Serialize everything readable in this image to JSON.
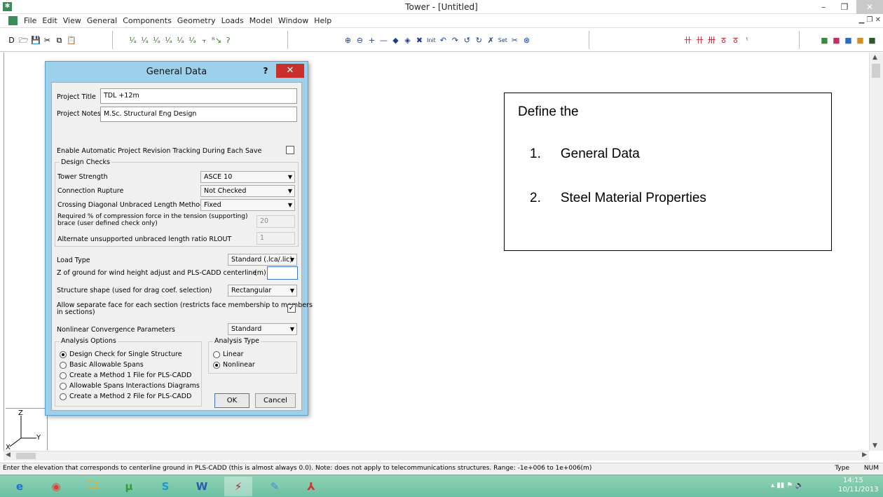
{
  "window": {
    "title": "Tower - [Untitled]",
    "min": "–",
    "max": "❐",
    "close": "✕"
  },
  "menu": [
    "File",
    "Edit",
    "View",
    "General",
    "Components",
    "Geometry",
    "Loads",
    "Model",
    "Window",
    "Help"
  ],
  "toolbar": {
    "file_icons": [
      "D",
      "🗁",
      "💾",
      "✂",
      "⧉",
      "📋"
    ],
    "geom_icons": [
      "⅟ₐ",
      "⅟ₐ",
      "⅟ₐ",
      "⅟ₐ",
      "⅟ₐ",
      "⅟ₐ",
      "⫟",
      "ᴿ↘",
      "ʔ"
    ],
    "view_icons": [
      "⊕",
      "⊖",
      "+",
      "—",
      "◆",
      "◈",
      "✖",
      "Init",
      "↶",
      "↷",
      "↺",
      "↻",
      "✗",
      "Set",
      "✂",
      "⊗"
    ],
    "model_icons": [
      "卄",
      "卄",
      "卅",
      "ठ",
      "ठ",
      "ᵗ"
    ],
    "color_icons": [
      "■",
      "■",
      "■",
      "■",
      "■"
    ]
  },
  "dialog": {
    "title": "General Data",
    "help": "?",
    "close": "✕",
    "project_title_label": "Project Title",
    "project_title_value": "TDL +12m",
    "project_notes_label": "Project Notes",
    "project_notes_value": "M.Sc. Structural Eng Design",
    "auto_revision_label": "Enable Automatic Project Revision Tracking During Each Save",
    "design_checks_label": "Design Checks",
    "tower_strength_label": "Tower Strength",
    "tower_strength_value": "ASCE 10",
    "connection_rupture_label": "Connection Rupture",
    "connection_rupture_value": "Not Checked",
    "crossing_label": "Crossing Diagonal Unbraced Length Method",
    "crossing_value": "Fixed",
    "required_pct_label_1": "Required % of compression force in the tension (supporting)",
    "required_pct_label_2": "brace (user defined check only)",
    "required_pct_value": "20",
    "rlout_label": "Alternate unsupported unbraced length ratio RLOUT",
    "rlout_value": "1",
    "load_type_label": "Load Type",
    "load_type_value": "Standard (.lca/.lic)",
    "z_ground_label": "Z of ground for wind height adjust and PLS-CADD centerline",
    "z_ground_unit": "(m)",
    "shape_label": "Structure shape (used for drag coef. selection)",
    "shape_value": "Rectangular",
    "separate_face_label_1": "Allow separate face for each section (restricts face membership to members",
    "separate_face_label_2": "in sections)",
    "separate_face_check": "✓",
    "nonlinear_label": "Nonlinear Convergence Parameters",
    "nonlinear_value": "Standard",
    "analysis_options_label": "Analysis Options",
    "analysis_options": [
      "Design Check for Single Structure",
      "Basic Allowable Spans",
      "Create a Method 1 File for PLS-CADD",
      "Allowable Spans Interactions Diagrams",
      "Create a Method 2 File for PLS-CADD"
    ],
    "analysis_type_label": "Analysis Type",
    "analysis_types": [
      "Linear",
      "Nonlinear"
    ],
    "ok": "OK",
    "cancel": "Cancel"
  },
  "note": {
    "heading": "Define the",
    "items": [
      {
        "num": "1.",
        "text": "General Data"
      },
      {
        "num": "2.",
        "text": "Steel Material Properties"
      }
    ]
  },
  "axes": {
    "z": "Z",
    "x": "X",
    "y": "Y"
  },
  "status": {
    "message": "Enter the elevation that corresponds to centerline ground in PLS-CADD (this is almost always 0.0).  Note: does not apply to telecommunications structures.  Range: -1e+006 to 1e+006(m)",
    "type": "Type",
    "num": "NUM"
  },
  "taskbar": {
    "apps": [
      "e",
      "◉",
      "🗀",
      "μ",
      "S",
      "W",
      "⚡",
      "✎",
      "⅄"
    ],
    "time": "14:15",
    "date": "10/11/2013"
  },
  "colors": {
    "dialog_frame": "#9dd0ea",
    "close_red": "#c9302c",
    "taskbar": "#7ccab0"
  }
}
